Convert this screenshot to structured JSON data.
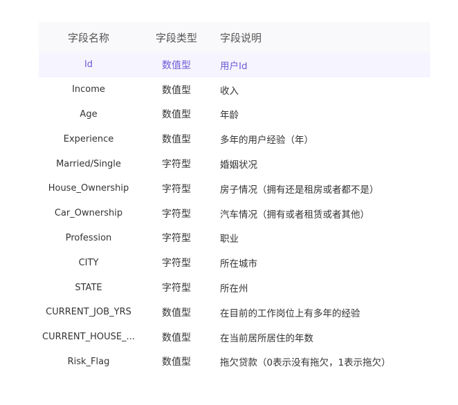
{
  "table": {
    "headers": {
      "name": "字段名称",
      "type": "字段类型",
      "desc": "字段说明"
    },
    "rows": [
      {
        "name": "Id",
        "type": "数值型",
        "desc": "用户Id"
      },
      {
        "name": "Income",
        "type": "数值型",
        "desc": "收入"
      },
      {
        "name": "Age",
        "type": "数值型",
        "desc": "年龄"
      },
      {
        "name": "Experience",
        "type": "数值型",
        "desc": "多年的用户经验（年）"
      },
      {
        "name": "Married/Single",
        "type": "字符型",
        "desc": "婚姻状况"
      },
      {
        "name": "House_Ownership",
        "type": "字符型",
        "desc": "房子情况（拥有还是租房或者都不是）"
      },
      {
        "name": "Car_Ownership",
        "type": "字符型",
        "desc": "汽车情况（拥有或者租赁或者其他）"
      },
      {
        "name": "Profession",
        "type": "字符型",
        "desc": "职业"
      },
      {
        "name": "CITY",
        "type": "字符型",
        "desc": "所在城市"
      },
      {
        "name": "STATE",
        "type": "字符型",
        "desc": "所在州"
      },
      {
        "name": "CURRENT_JOB_YRS",
        "type": "数值型",
        "desc": "在目前的工作岗位上有多年的经验"
      },
      {
        "name": "CURRENT_HOUSE_...",
        "type": "数值型",
        "desc": "在当前居所居住的年数"
      },
      {
        "name": "Risk_Flag",
        "type": "数值型",
        "desc": "拖欠贷款（0表示没有拖欠，1表示拖欠）"
      }
    ]
  },
  "colors": {
    "header_bg": "#f9f9fb",
    "highlight_bg": "#f6f4ff",
    "highlight_text": "#6b5bd6"
  }
}
